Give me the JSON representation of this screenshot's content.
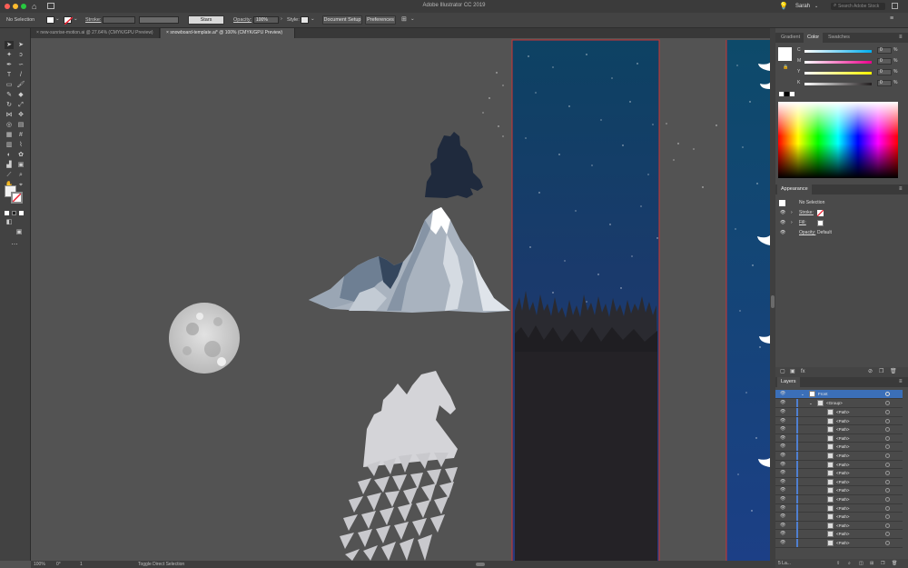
{
  "window": {
    "title": "Adobe Illustrator CC 2019",
    "user": "Sarah",
    "search_placeholder": "Search Adobe Stock"
  },
  "control_bar": {
    "selection": "No Selection",
    "stroke_label": "Stroke:",
    "graphic_style": "Stars",
    "opacity_label": "Opacity:",
    "opacity_value": "100%",
    "style_label": "Style:",
    "document_setup": "Document Setup",
    "preferences": "Preferences"
  },
  "tabs": [
    {
      "label": "new-sunrise-motion.ai @ 27.64% (CMYK/GPU Preview)"
    },
    {
      "label": "snowboard-template.ai* @ 100% (CMYK/GPU Preview)"
    }
  ],
  "status_bar": {
    "zoom": "100%",
    "rotation": "0°",
    "artboard": "1",
    "message": "Toggle Direct Selection"
  },
  "color_panel": {
    "tabs": [
      "Gradient",
      "Color",
      "Swatches"
    ],
    "active_tab": "Color",
    "channels": [
      {
        "label": "C",
        "value": "0",
        "color": "#00aeef"
      },
      {
        "label": "M",
        "value": "0",
        "color": "#ec008c"
      },
      {
        "label": "Y",
        "value": "0",
        "color": "#fff200"
      },
      {
        "label": "K",
        "value": "0",
        "color": "#231f20"
      }
    ],
    "unit": "%"
  },
  "appearance_panel": {
    "title": "Appearance",
    "selection": "No Selection",
    "stroke_label": "Stroke:",
    "fill_label": "Fill:",
    "opacity_label": "Opacity:",
    "opacity_value": "Default"
  },
  "layers_panel": {
    "title": "Layers",
    "layer_name": "Front",
    "group_name": "<Group>",
    "items": [
      "<Path>",
      "<Path>",
      "<Path>",
      "<Path>",
      "<Path>",
      "<Path>",
      "<Path>",
      "<Path>",
      "<Path>",
      "<Path>",
      "<Path>",
      "<Path>",
      "<Path>",
      "<Path>",
      "<Path>",
      "<Path>"
    ],
    "count_label": "5 La..."
  }
}
